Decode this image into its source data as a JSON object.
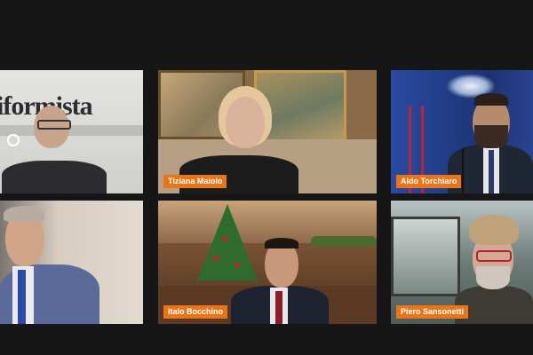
{
  "call": {
    "brand_text": "iformista",
    "participants": [
      {
        "name": ""
      },
      {
        "name": "Tiziana Maiolo"
      },
      {
        "name": "Aldo Torchiaro"
      },
      {
        "name": ""
      },
      {
        "name": "Italo Bocchino"
      },
      {
        "name": "Piero Sansonetti"
      }
    ]
  },
  "colors": {
    "background": "#161616",
    "name_tag": "#e8751a",
    "name_tag_text": "#ffffff"
  }
}
